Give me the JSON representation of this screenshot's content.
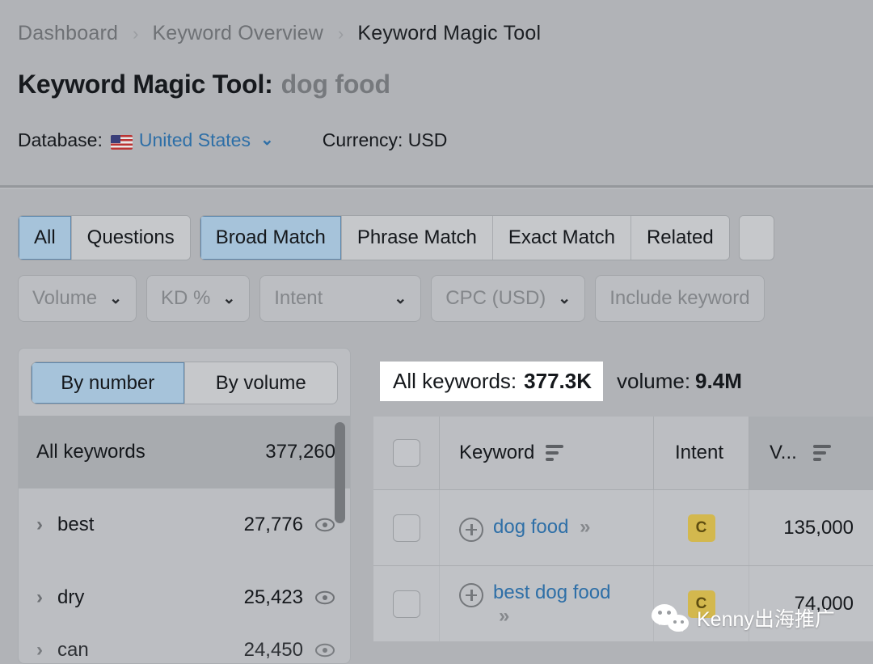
{
  "breadcrumb": {
    "items": [
      "Dashboard",
      "Keyword Overview",
      "Keyword Magic Tool"
    ],
    "separator": "›"
  },
  "page": {
    "title": "Keyword Magic Tool:",
    "term": "dog food"
  },
  "meta": {
    "database_label": "Database:",
    "database_value": "United States",
    "database_chevron": "⌄",
    "flag_icon": "us-flag-icon",
    "currency": "Currency: USD"
  },
  "tabs": {
    "group1": [
      {
        "label": "All",
        "active": true
      },
      {
        "label": "Questions",
        "active": false
      }
    ],
    "group2": [
      {
        "label": "Broad Match",
        "active": true
      },
      {
        "label": "Phrase Match",
        "active": false
      },
      {
        "label": "Exact Match",
        "active": false
      },
      {
        "label": "Related",
        "active": false
      }
    ]
  },
  "filters": [
    {
      "label": "Volume",
      "chevron": "⌄",
      "kind": "dropdown"
    },
    {
      "label": "KD %",
      "chevron": "⌄",
      "kind": "dropdown"
    },
    {
      "label": "Intent",
      "chevron": "⌄",
      "kind": "dropdown"
    },
    {
      "label": "CPC (USD)",
      "chevron": "⌄",
      "kind": "dropdown"
    },
    {
      "label": "Include keyword",
      "chevron": "",
      "kind": "input"
    }
  ],
  "left_panel": {
    "segments": [
      {
        "label": "By number",
        "active": true
      },
      {
        "label": "By volume",
        "active": false
      }
    ],
    "rows": [
      {
        "name": "All keywords",
        "count": "377,260",
        "selected": true,
        "has_caret": false,
        "has_eye": false
      },
      {
        "name": "best",
        "count": "27,776",
        "selected": false,
        "has_caret": true,
        "has_eye": true
      },
      {
        "name": "dry",
        "count": "25,423",
        "selected": false,
        "has_caret": true,
        "has_eye": true
      },
      {
        "name": "can",
        "count": "24,450",
        "selected": false,
        "has_caret": true,
        "has_eye": true
      }
    ],
    "caret_glyph": "›",
    "eye_icon": "eye-icon"
  },
  "summary": {
    "all_keywords_label": "All keywords:",
    "all_keywords_value": "377.3K",
    "volume_label": "volume:",
    "volume_value": "9.4M",
    "highlighted": true
  },
  "table": {
    "columns": [
      {
        "key": "checkbox",
        "label": ""
      },
      {
        "key": "keyword",
        "label": "Keyword",
        "sortable": true
      },
      {
        "key": "intent",
        "label": "Intent",
        "sortable": false
      },
      {
        "key": "volume",
        "label": "V...",
        "sortable": true,
        "active_sort": true
      }
    ],
    "rows": [
      {
        "keyword": "dog food",
        "chevrons": "»",
        "intent": "C",
        "volume": "135,000"
      },
      {
        "keyword": "best dog food",
        "chevrons": "»",
        "intent": "C",
        "volume": "74,000"
      }
    ]
  },
  "watermark": {
    "text": "Kenny出海推广",
    "icon": "wechat-icon"
  },
  "colors": {
    "page_bg": "#b1b3b7",
    "accent_blue": "#2e6fa7",
    "tab_active": "#a6c3da",
    "tab_active_border": "#5d86ab",
    "intent_badge": "#d3b84e",
    "highlight_bg": "#ffffff",
    "panel_bg": "#bcbec2"
  }
}
